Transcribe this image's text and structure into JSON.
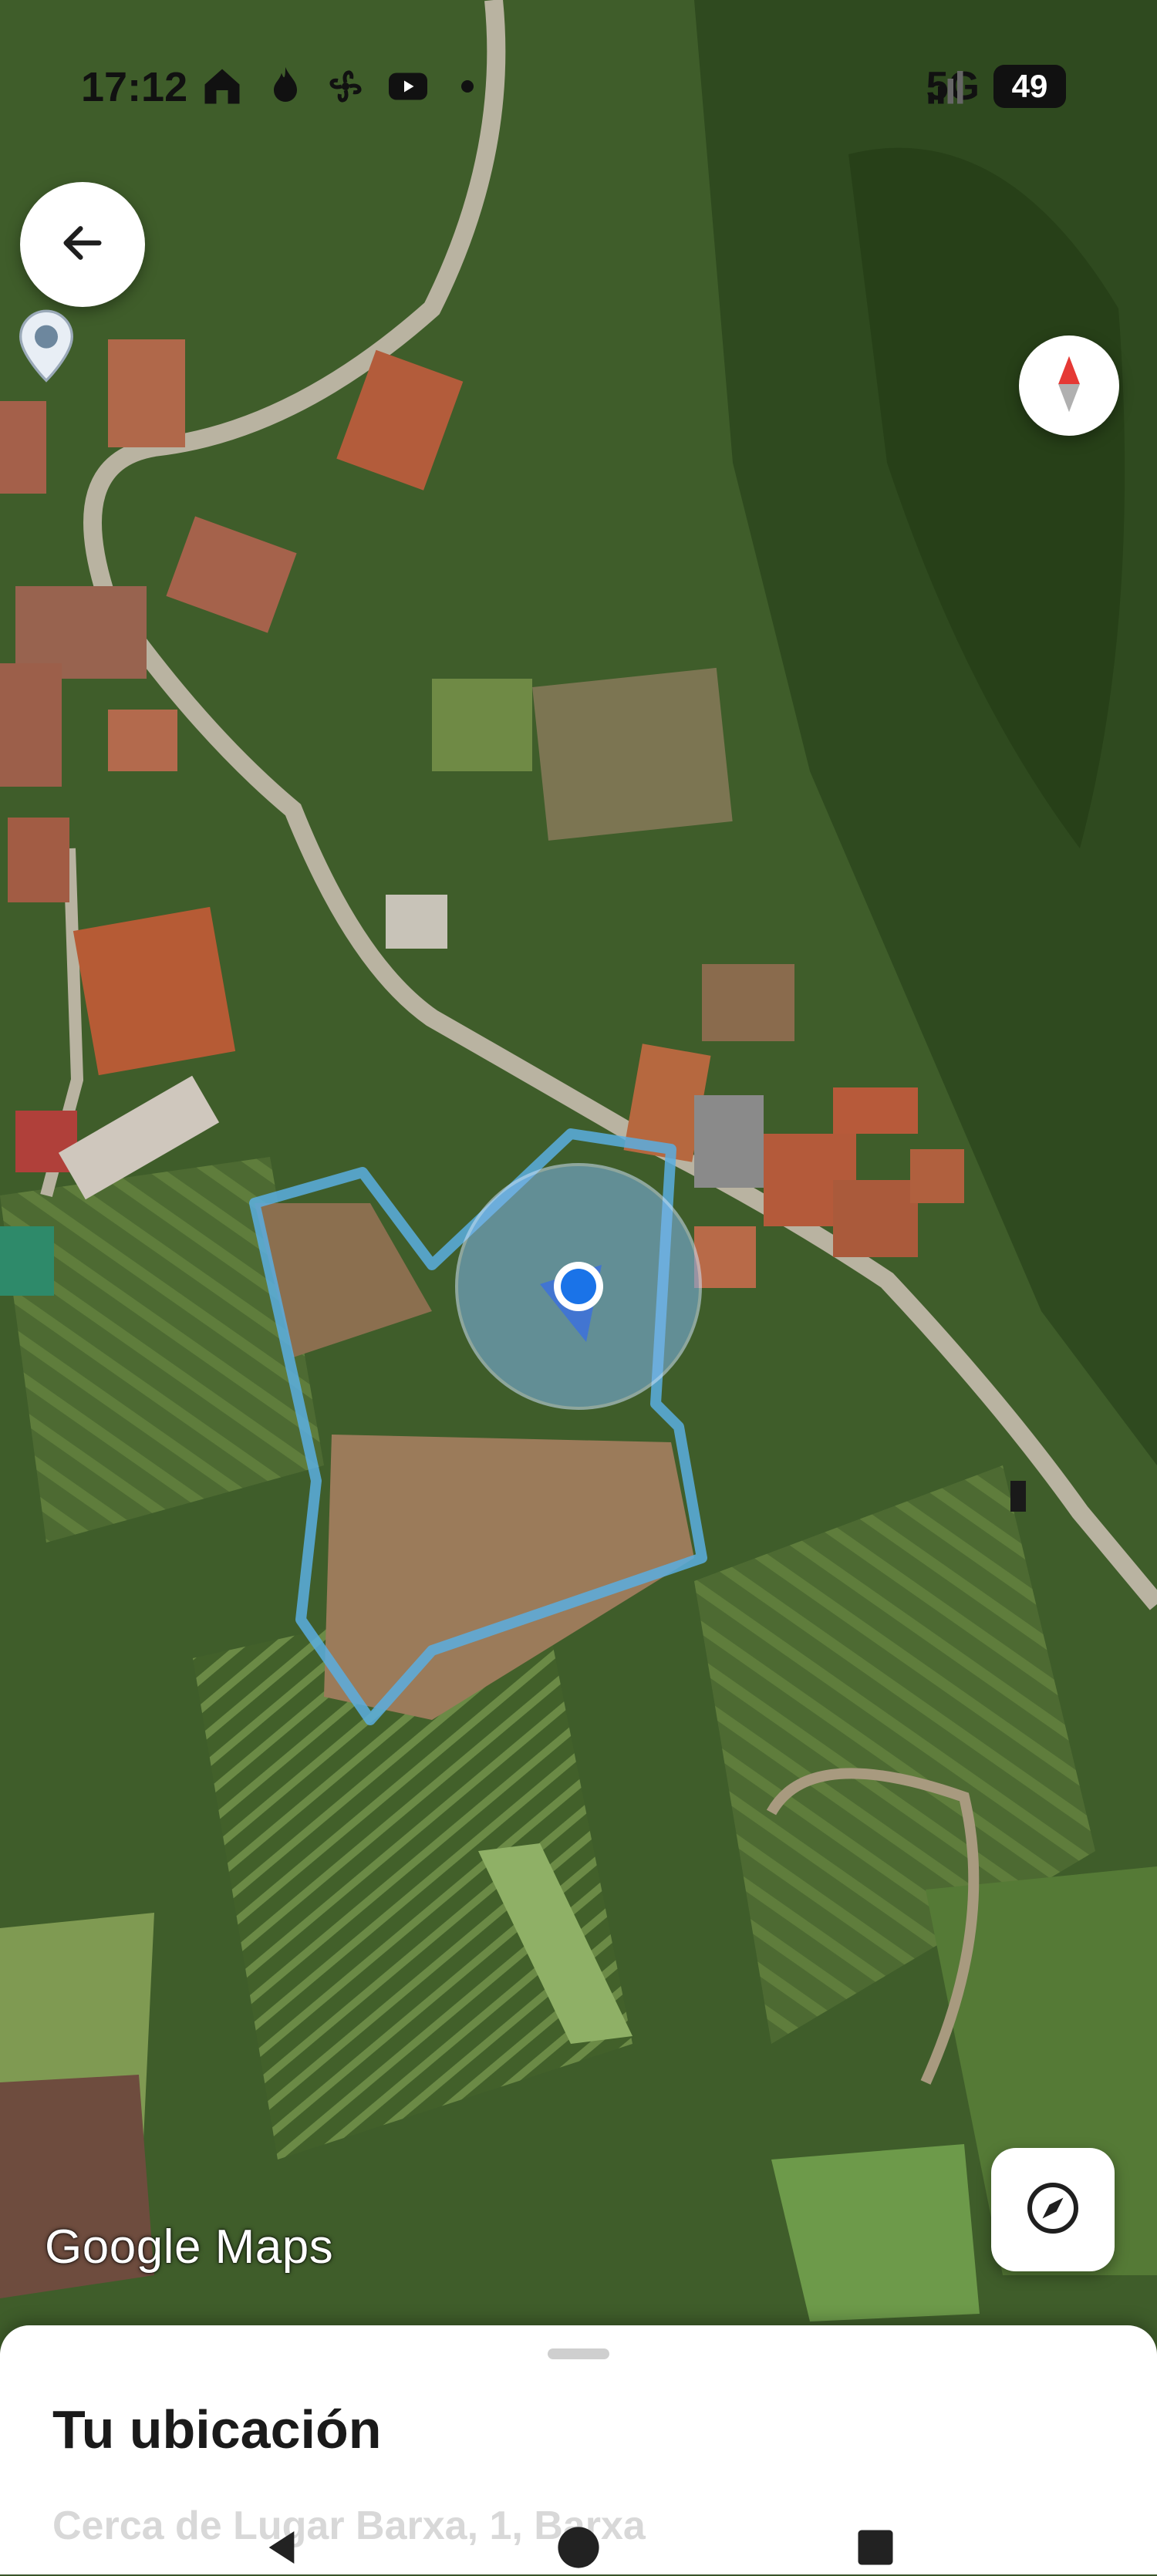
{
  "status_bar": {
    "time": "17:12",
    "network": "5G",
    "battery": "49",
    "icons": [
      "home-icon",
      "flame-icon",
      "fan-icon",
      "youtube-icon",
      "dot-icon",
      "signal-icon"
    ]
  },
  "map": {
    "type": "satellite",
    "attribution": "Google Maps",
    "colors": {
      "location_blue": "#1a73e8",
      "boundary": "#5aaee0"
    }
  },
  "controls": {
    "back": "back-arrow-icon",
    "compass": "compass-icon",
    "my_location": "navigation-icon"
  },
  "sheet": {
    "title": "Tu ubicación",
    "address": "Cerca de Lugar Barxa, 1, Barxa"
  },
  "nav_bar": {
    "buttons": [
      "back-triangle-icon",
      "home-circle-icon",
      "recents-square-icon"
    ]
  }
}
